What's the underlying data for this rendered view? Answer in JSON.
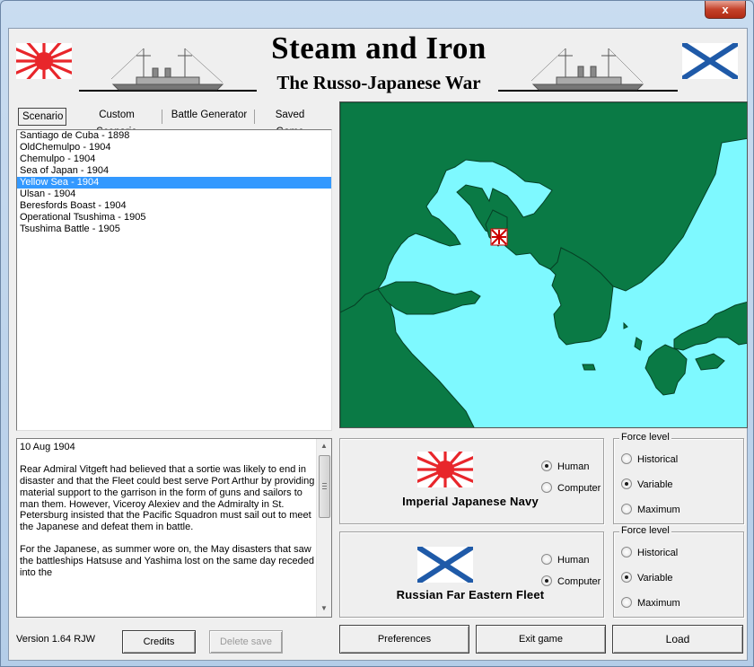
{
  "window": {
    "close_label": "x"
  },
  "header": {
    "title": "Steam and Iron",
    "subtitle": "The Russo-Japanese War",
    "flag_left": "rising-sun-flag",
    "flag_right": "st-andrew-ensign"
  },
  "tabs": [
    {
      "label": "Scenario",
      "active": true
    },
    {
      "label": "Custom Scenario",
      "active": false
    },
    {
      "label": "Battle Generator",
      "active": false
    },
    {
      "label": "Saved Game",
      "active": false
    }
  ],
  "scenarios": [
    "Santiago de Cuba - 1898",
    "OldChemulpo - 1904",
    "Chemulpo - 1904",
    "Sea of Japan - 1904",
    "Yellow Sea - 1904",
    "Ulsan - 1904",
    "Beresfords Boast - 1904",
    "Operational Tsushima - 1905",
    "Tsushima Battle - 1905"
  ],
  "selected_scenario": "Yellow Sea - 1904",
  "description": {
    "date": "10 Aug 1904",
    "paragraphs": [
      "Rear Admiral Vitgeft had believed that a sortie was likely to end in disaster and that the Fleet could best serve Port Arthur by providing material support to the garrison in the form of guns and sailors to man them.  However, Viceroy Alexiev and the Admiralty in St. Petersburg insisted that the Pacific Squadron must sail out to meet the Japanese and defeat them in battle.",
      "For the Japanese, as summer wore on, the May disasters that saw the battleships Hatsuse and Yashima lost on the same day receded into the"
    ]
  },
  "colors": {
    "sea": "#7ef9ff",
    "land": "#0a7a45",
    "selection": "#3399ff"
  },
  "navies": [
    {
      "name": "Imperial Japanese Navy",
      "flag": "rising-sun-flag",
      "options": [
        {
          "label": "Human",
          "checked": true
        },
        {
          "label": "Computer",
          "checked": false
        }
      ],
      "force_legend": "Force level",
      "force_options": [
        {
          "label": "Historical",
          "checked": false
        },
        {
          "label": "Variable",
          "checked": true
        },
        {
          "label": "Maximum",
          "checked": false
        }
      ]
    },
    {
      "name": "Russian Far Eastern Fleet",
      "flag": "st-andrew-ensign",
      "options": [
        {
          "label": "Human",
          "checked": false
        },
        {
          "label": "Computer",
          "checked": true
        }
      ],
      "force_legend": "Force level",
      "force_options": [
        {
          "label": "Historical",
          "checked": false
        },
        {
          "label": "Variable",
          "checked": true
        },
        {
          "label": "Maximum",
          "checked": false
        }
      ]
    }
  ],
  "footer": {
    "version": "Version 1.64 RJW",
    "credits": "Credits",
    "delete_save": "Delete save",
    "preferences": "Preferences",
    "exit_game": "Exit game",
    "load": "Load"
  }
}
